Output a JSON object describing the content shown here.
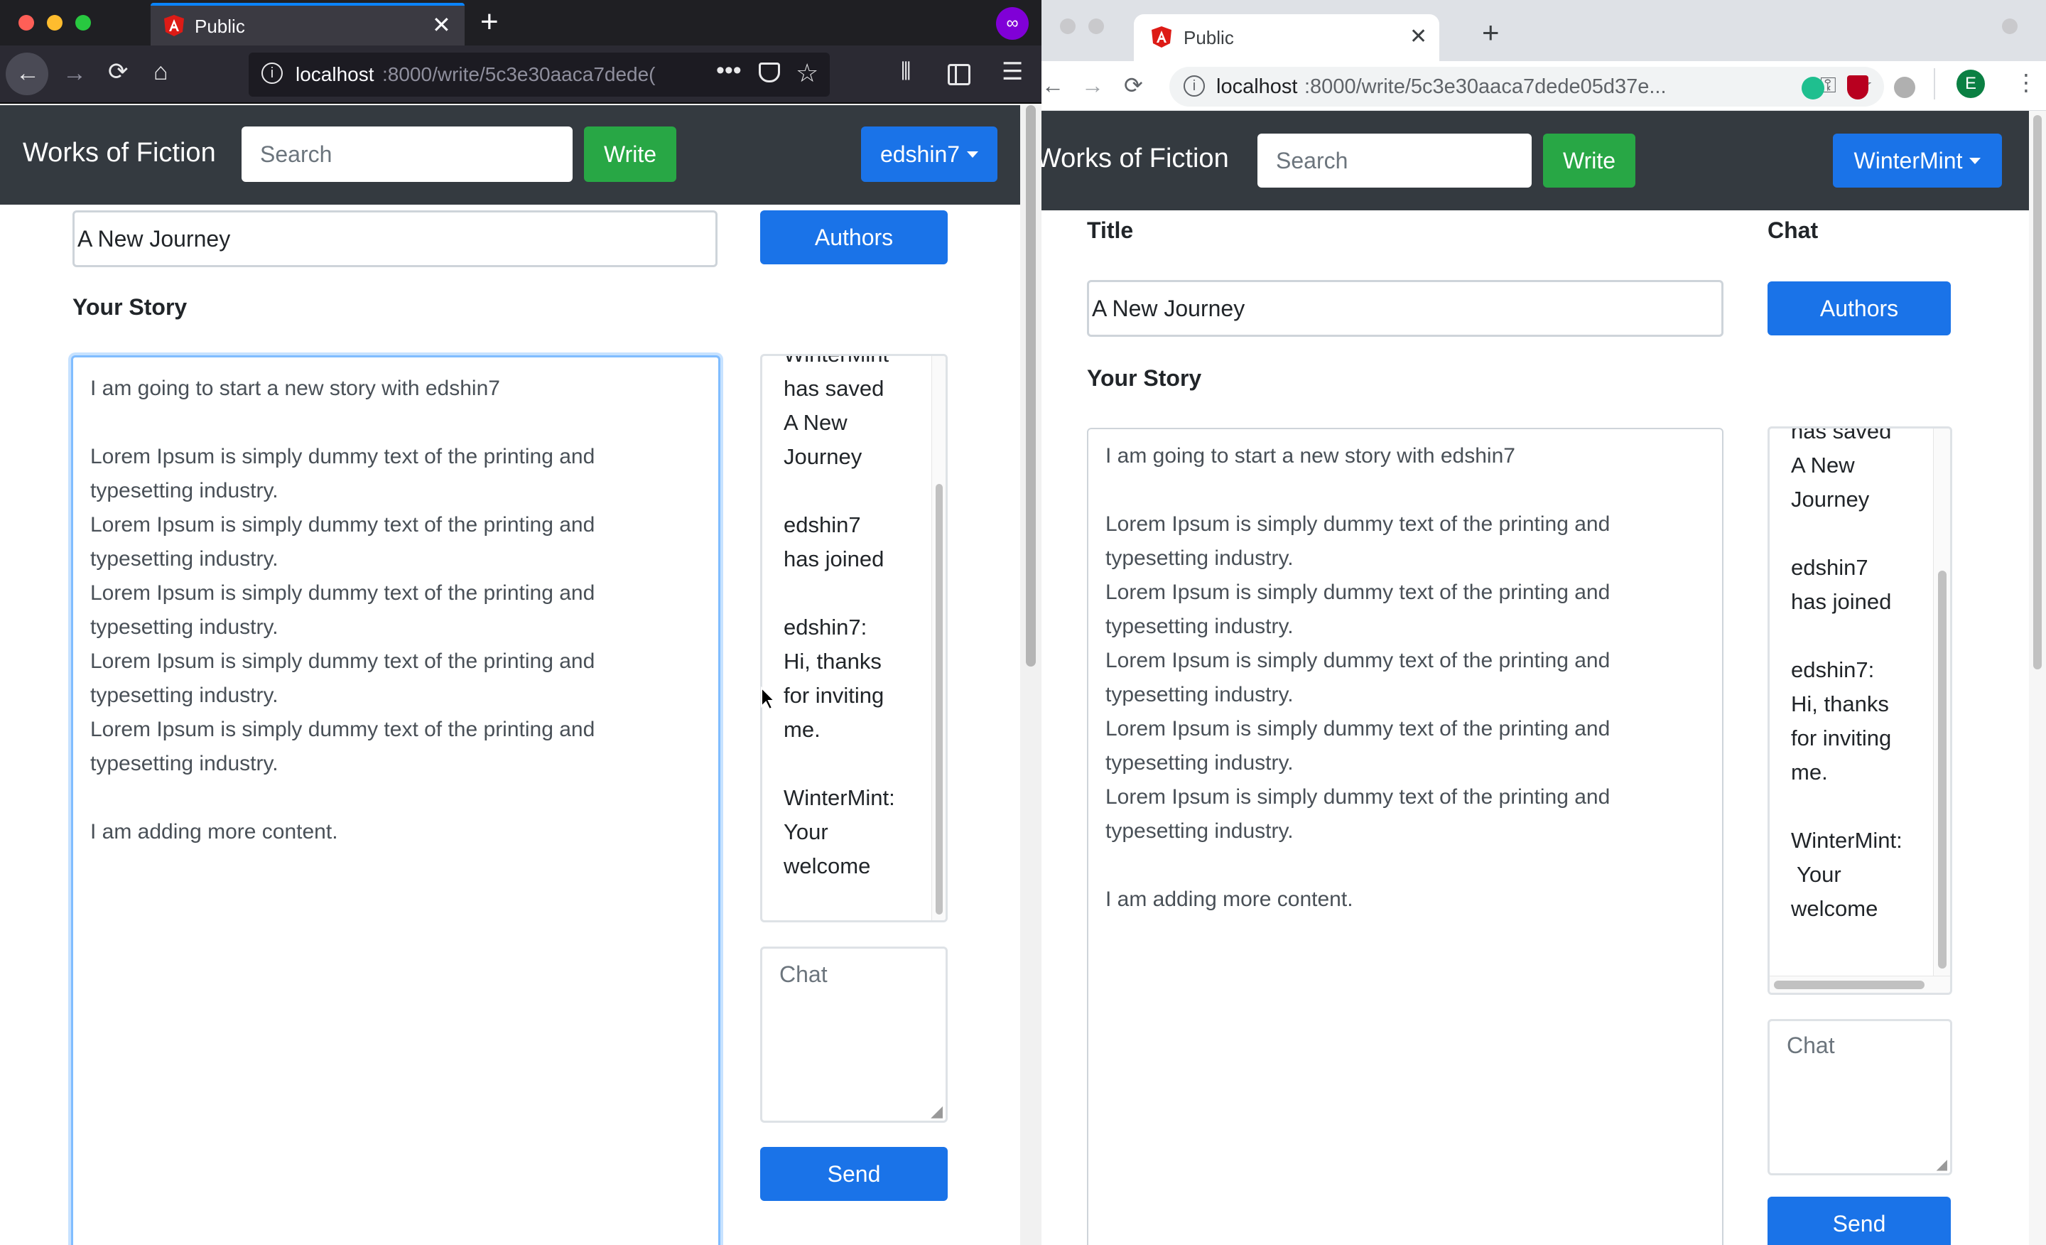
{
  "left_window": {
    "tab_title": "Public",
    "url_host": "localhost",
    "url_path": ":8000/write/5c3e30aaca7dede(",
    "brand": "Works of Fiction",
    "search_placeholder": "Search",
    "write_label": "Write",
    "user_label": "edshin7",
    "title_value": "A New Journey",
    "authors_label": "Authors",
    "story_heading": "Your Story",
    "story_lines": [
      "I am going to start a new story with edshin7",
      "",
      "Lorem Ipsum is simply dummy text of the printing and",
      "typesetting industry.",
      "Lorem Ipsum is simply dummy text of the printing and",
      "typesetting industry.",
      "Lorem Ipsum is simply dummy text of the printing and",
      "typesetting industry.",
      "Lorem Ipsum is simply dummy text of the printing and",
      "typesetting industry.",
      "Lorem Ipsum is simply dummy text of the printing and",
      "typesetting industry.",
      "",
      "I am adding more content."
    ],
    "chat_lines": [
      "WinterMint",
      "has saved",
      "A New",
      "Journey",
      "",
      "edshin7",
      "has joined",
      "",
      "edshin7:",
      "Hi, thanks",
      "for inviting",
      "me.",
      "",
      "WinterMint:",
      "Your",
      "welcome"
    ],
    "chat_placeholder": "Chat",
    "send_label": "Send"
  },
  "right_window": {
    "tab_title": "Public",
    "url_host": "localhost",
    "url_path": ":8000/write/5c3e30aaca7dede05d37e...",
    "brand": "Works of Fiction",
    "search_placeholder": "Search",
    "write_label": "Write",
    "user_label": "WinterMint",
    "profile_initial": "E",
    "title_heading": "Title",
    "chat_heading": "Chat",
    "title_value": "A New Journey",
    "authors_label": "Authors",
    "story_heading": "Your Story",
    "story_lines": [
      "I am going to start a new story with edshin7",
      "",
      "Lorem Ipsum is simply dummy text of the printing and",
      "typesetting industry.",
      "Lorem Ipsum is simply dummy text of the printing and",
      "typesetting industry.",
      "Lorem Ipsum is simply dummy text of the printing and",
      "typesetting industry.",
      "Lorem Ipsum is simply dummy text of the printing and",
      "typesetting industry.",
      "Lorem Ipsum is simply dummy text of the printing and",
      "typesetting industry.",
      "",
      "I am adding more content."
    ],
    "chat_lines": [
      "has saved",
      "A New",
      "Journey",
      "",
      "edshin7",
      "has joined",
      "",
      "edshin7:",
      "Hi, thanks",
      "for inviting",
      "me.",
      "",
      "WinterMint:",
      " Your",
      "welcome"
    ],
    "chat_placeholder": "Chat",
    "send_label": "Send"
  },
  "colors": {
    "navbar": "#343a40",
    "primary": "#1a73e8",
    "success": "#28a745",
    "firefox_chrome": "#2b2a33",
    "chrome_chrome": "#dee1e6"
  }
}
